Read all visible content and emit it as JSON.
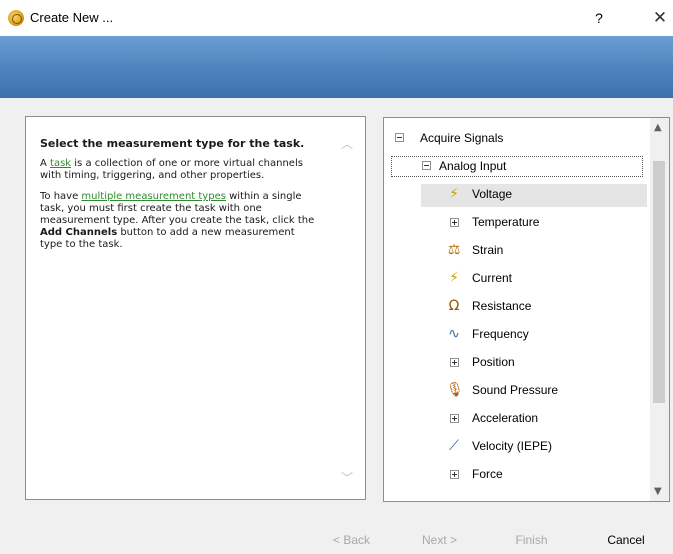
{
  "window": {
    "title": "Create New ...",
    "help_label": "?",
    "close_label": "✕"
  },
  "help": {
    "title": "Select the measurement type for the task.",
    "p1_pre": "A ",
    "p1_link": "task",
    "p1_post": " is a collection of one or more virtual channels with timing, triggering, and other properties.",
    "p2_pre": "To have ",
    "p2_link": "multiple measurement types",
    "p2_mid": " within a single task, you must first create the task with one measurement type. After you create the task, click the ",
    "p2_bold": "Add Channels",
    "p2_post": " button to add a new measurement type to the task."
  },
  "tree": {
    "root": "Acquire Signals",
    "group": "Analog Input",
    "items": [
      {
        "label": "Voltage",
        "icon": "voltage-icon",
        "glyph": "⚡",
        "expandable": false,
        "selected": true
      },
      {
        "label": "Temperature",
        "icon": "expander",
        "glyph": "",
        "expandable": true,
        "selected": false
      },
      {
        "label": "Strain",
        "icon": "strain-icon",
        "glyph": "⚖",
        "expandable": false,
        "selected": false
      },
      {
        "label": "Current",
        "icon": "current-icon",
        "glyph": "⚡",
        "expandable": false,
        "selected": false
      },
      {
        "label": "Resistance",
        "icon": "resistance-icon",
        "glyph": "Ω",
        "expandable": false,
        "selected": false
      },
      {
        "label": "Frequency",
        "icon": "frequency-icon",
        "glyph": "∿",
        "expandable": false,
        "selected": false
      },
      {
        "label": "Position",
        "icon": "expander",
        "glyph": "",
        "expandable": true,
        "selected": false
      },
      {
        "label": "Sound Pressure",
        "icon": "microphone-icon",
        "glyph": "🎙",
        "expandable": false,
        "selected": false
      },
      {
        "label": "Acceleration",
        "icon": "expander",
        "glyph": "",
        "expandable": true,
        "selected": false
      },
      {
        "label": "Velocity (IEPE)",
        "icon": "velocity-icon",
        "glyph": "⟋",
        "expandable": false,
        "selected": false
      },
      {
        "label": "Force",
        "icon": "expander",
        "glyph": "",
        "expandable": true,
        "selected": false
      }
    ]
  },
  "buttons": {
    "back": "< Back",
    "next": "Next >",
    "finish": "Finish",
    "cancel": "Cancel"
  },
  "colors": {
    "banner_top": "#6b9ed2",
    "banner_bottom": "#3b72ae",
    "link": "#2e8b2e",
    "selected_row": "#e5e5e5"
  }
}
